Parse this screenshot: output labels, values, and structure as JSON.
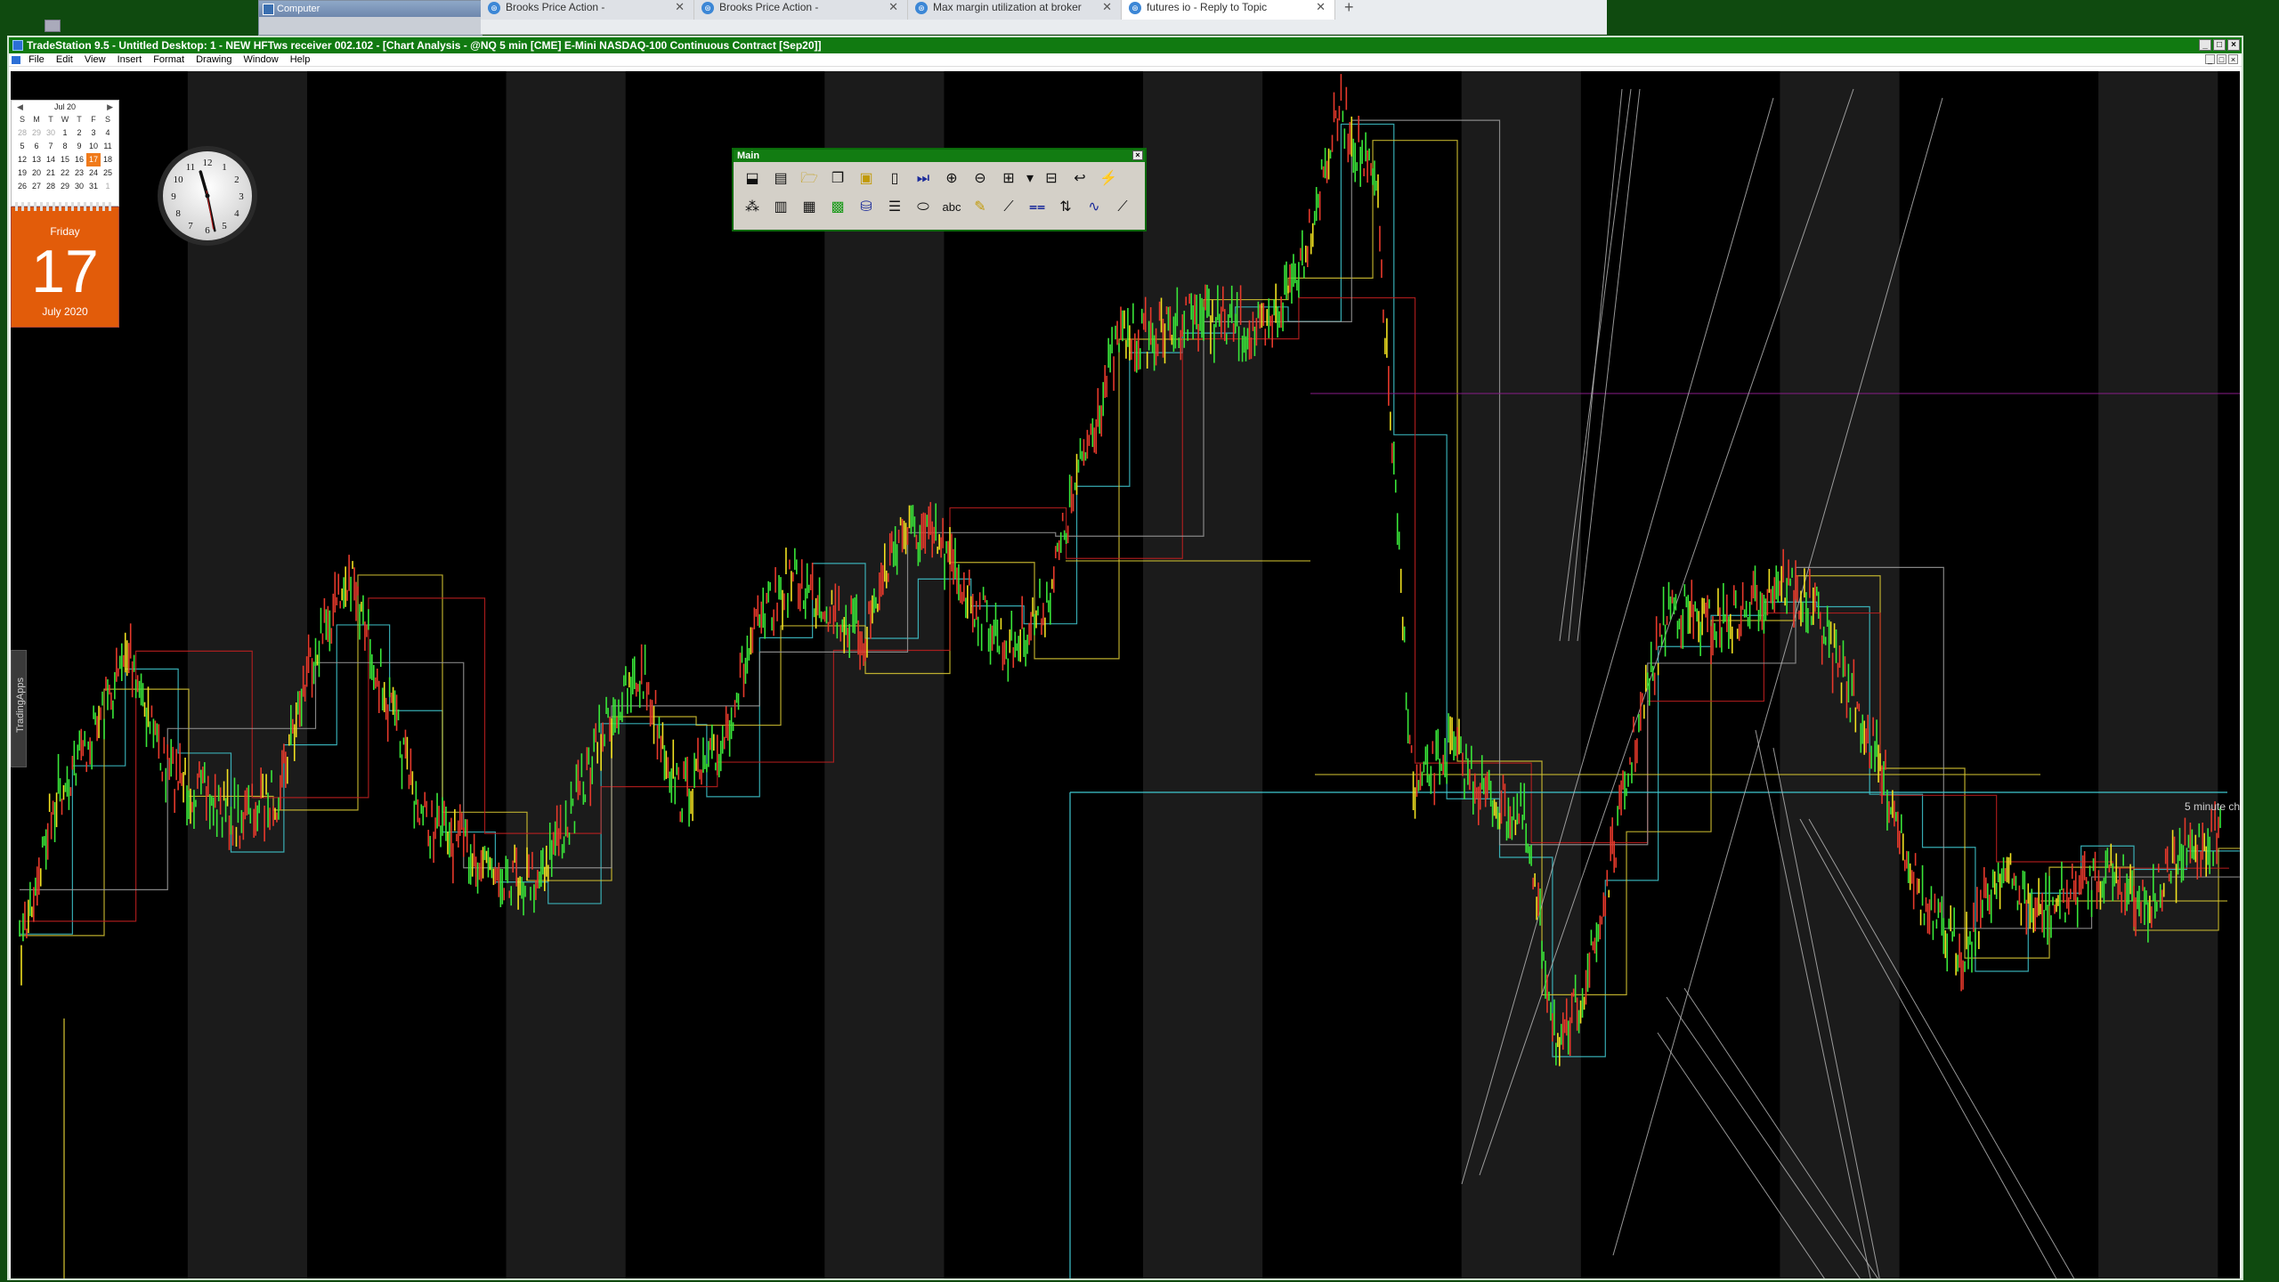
{
  "desktop": {
    "background_color": "#0f4a0f",
    "background_window_title": "Computer",
    "browser_tabs": [
      {
        "label": "Brooks Price Action -",
        "active": false
      },
      {
        "label": "Brooks Price Action -",
        "active": false
      },
      {
        "label": "Max margin utilization at broker",
        "active": false
      },
      {
        "label": "futures io - Reply to Topic",
        "active": true
      }
    ],
    "new_tab_label": "+"
  },
  "tradestation": {
    "title": "TradeStation 9.5 - Untitled Desktop: 1 - NEW HFTws receiver 002.102 - [Chart Analysis - @NQ 5 min [CME] E-Mini NASDAQ-100 Continuous Contract [Sep20]]",
    "menu": [
      "File",
      "Edit",
      "View",
      "Insert",
      "Format",
      "Drawing",
      "Window",
      "Help"
    ],
    "window_buttons": {
      "minimize": "_",
      "maximize": "□",
      "close": "×"
    },
    "side_tab_label": "TradingApps",
    "chart_annotation": "5 minute ch"
  },
  "toolbar": {
    "title": "Main",
    "close_label": "×",
    "row1_icons": [
      "chart-analysis-icon",
      "new-window-icon",
      "open-icon",
      "copy-icon",
      "paste-icon",
      "page-icon",
      "last-bar-icon",
      "zoom-in-icon",
      "zoom-out-icon",
      "insert-symbol-icon",
      "dropdown-icon",
      "data-window-icon",
      "curve-icon",
      "indicator-icon"
    ],
    "row2_icons": [
      "strategy-icon",
      "format-icon",
      "bars-icon",
      "color-bars-icon",
      "database-icon",
      "lines-icon",
      "ellipse-icon",
      "text-tool-icon",
      "pencil-icon",
      "trendline-icon",
      "horizontal-line-icon",
      "arrow-tool-icon",
      "wave-icon",
      "fib-icon"
    ],
    "text_tool_label": "abc"
  },
  "gadgets": {
    "calendar": {
      "month_label": "Jul 20",
      "weekday_headers": [
        "S",
        "M",
        "T",
        "W",
        "T",
        "F",
        "S"
      ],
      "weeks": [
        [
          "28",
          "29",
          "30",
          "1",
          "2",
          "3",
          "4"
        ],
        [
          "5",
          "6",
          "7",
          "8",
          "9",
          "10",
          "11"
        ],
        [
          "12",
          "13",
          "14",
          "15",
          "16",
          "17",
          "18"
        ],
        [
          "19",
          "20",
          "21",
          "22",
          "23",
          "24",
          "25"
        ],
        [
          "26",
          "27",
          "28",
          "29",
          "30",
          "31",
          "1"
        ]
      ],
      "today": "17"
    },
    "day_card": {
      "weekday": "Friday",
      "day": "17",
      "month_year": "July 2020"
    },
    "clock": {
      "hour": 11,
      "minute": 28,
      "numerals": [
        "12",
        "1",
        "2",
        "3",
        "4",
        "5",
        "6",
        "7",
        "8",
        "9",
        "10",
        "11"
      ]
    }
  },
  "colors": {
    "candle_up": "#39e639",
    "candle_down": "#e6392b",
    "candle_yellow": "#f0e020",
    "level_cyan": "#3fc8d0",
    "level_yellow": "#d9c832",
    "level_red": "#c02020",
    "level_gray": "#9a9a9a",
    "session_band": "#1b1b1b",
    "title_green": "#117a11"
  },
  "chart_data": {
    "type": "candlestick",
    "symbol": "@NQ 5 min [CME] E-Mini NASDAQ-100 Continuous Contract [Sep20]",
    "price_path_norm": [
      0.73,
      0.6,
      0.55,
      0.48,
      0.58,
      0.6,
      0.62,
      0.6,
      0.48,
      0.42,
      0.52,
      0.62,
      0.64,
      0.66,
      0.67,
      0.62,
      0.54,
      0.5,
      0.6,
      0.57,
      0.47,
      0.42,
      0.44,
      0.47,
      0.38,
      0.39,
      0.44,
      0.48,
      0.44,
      0.32,
      0.22,
      0.22,
      0.2,
      0.21,
      0.22,
      0.15,
      0.03,
      0.1,
      0.6,
      0.56,
      0.6,
      0.62,
      0.82,
      0.72,
      0.56,
      0.44,
      0.46,
      0.45,
      0.42,
      0.45,
      0.52,
      0.6,
      0.7,
      0.73,
      0.66,
      0.7,
      0.68,
      0.66,
      0.69,
      0.65,
      0.63
    ],
    "session_bands": 14
  }
}
